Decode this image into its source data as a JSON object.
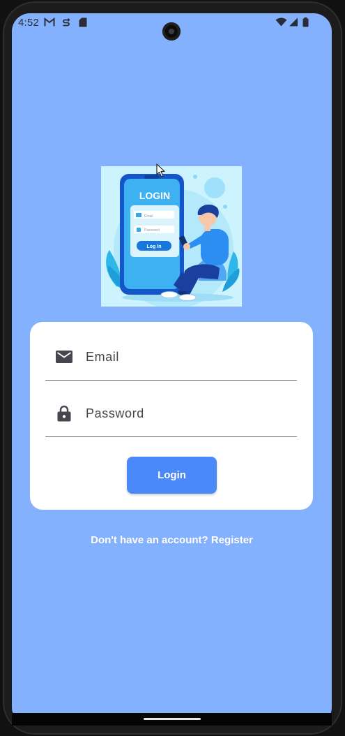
{
  "status_bar": {
    "time": "4:52",
    "left_icons": [
      "gmail-icon",
      "sync-icon",
      "sd-card-icon"
    ],
    "right_icons": [
      "wifi-icon",
      "cellular-signal-icon",
      "battery-icon"
    ]
  },
  "illustration": {
    "label": "LOGIN",
    "email_label": "Email",
    "password_label": "Password",
    "button_label": "Log In"
  },
  "form": {
    "email_placeholder": "Email",
    "password_placeholder": "Password",
    "login_label": "Login"
  },
  "register_link": "Don't have an account? Register",
  "colors": {
    "background": "#84b1fd",
    "card": "#ffffff",
    "button": "#4a89f7"
  }
}
